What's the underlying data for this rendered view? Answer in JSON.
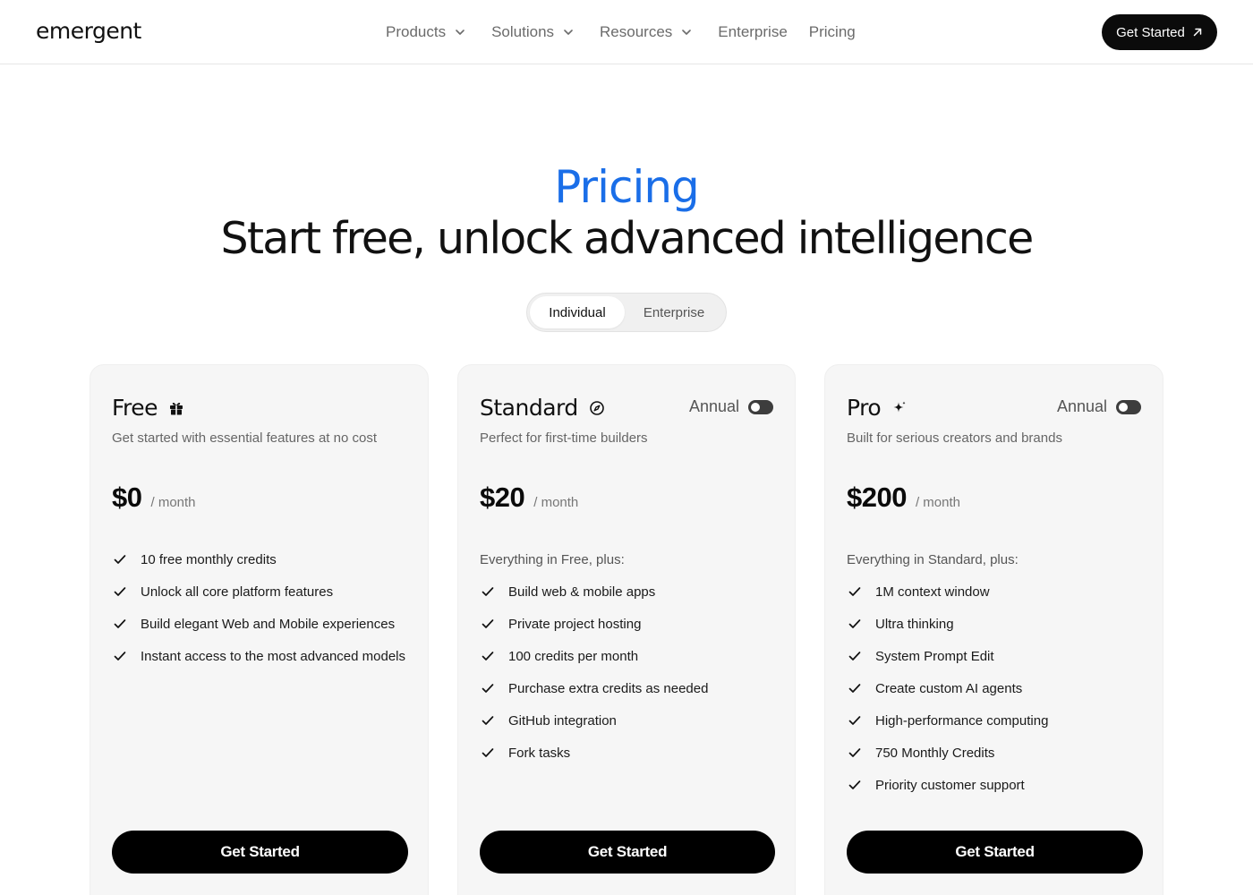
{
  "header": {
    "logo": "emergent",
    "nav": [
      {
        "label": "Products"
      },
      {
        "label": "Solutions"
      },
      {
        "label": "Resources"
      },
      {
        "label": "Enterprise"
      },
      {
        "label": "Pricing"
      }
    ],
    "cta_label": "Get Started"
  },
  "hero": {
    "eyebrow": "Pricing",
    "headline": "Start free, unlock advanced intelligence"
  },
  "plan_switch": {
    "options": [
      "Individual",
      "Enterprise"
    ],
    "selected": "Individual"
  },
  "plans": [
    {
      "name": "Free",
      "icon": "gift-icon",
      "description": "Get started with essential features at no cost",
      "price": "$0",
      "period": "/ month",
      "features": [
        "10 free monthly credits",
        "Unlock all core platform features",
        "Build elegant Web and Mobile experiences",
        "Instant access to the most advanced models"
      ],
      "button_label": "Get Started"
    },
    {
      "name": "Standard",
      "icon": "compass-icon",
      "annual_label": "Annual",
      "annual_on": false,
      "description": "Perfect for first-time builders",
      "price": "$20",
      "period": "/ month",
      "includes": "Everything in Free, plus:",
      "features": [
        "Build web & mobile apps",
        "Private project hosting",
        "100 credits per month",
        "Purchase extra credits as needed",
        "GitHub integration",
        "Fork tasks"
      ],
      "button_label": "Get Started"
    },
    {
      "name": "Pro",
      "icon": "sparkle-icon",
      "annual_label": "Annual",
      "annual_on": false,
      "description": "Built for serious creators and brands",
      "price": "$200",
      "period": "/ month",
      "includes": "Everything in Standard, plus:",
      "features": [
        "1M context window",
        "Ultra thinking",
        "System Prompt Edit",
        "Create custom AI agents",
        "High-performance computing",
        "750 Monthly Credits",
        "Priority customer support"
      ],
      "button_label": "Get Started"
    }
  ],
  "colors": {
    "accent": "#1a6ee8",
    "button": "#000000",
    "card_bg": "#f6f6f6"
  }
}
